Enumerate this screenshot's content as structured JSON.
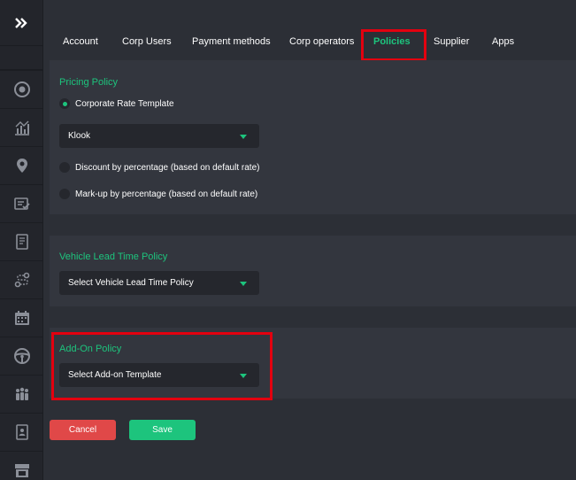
{
  "sidebar": {
    "icons": [
      "expand-icon",
      "plus-circle-icon",
      "analytics-icon",
      "location-pin-icon",
      "checklist-icon",
      "document-icon",
      "route-icon",
      "calendar-icon",
      "steering-wheel-icon",
      "users-group-icon",
      "id-card-icon",
      "storefront-icon"
    ]
  },
  "tabs": [
    {
      "label": "Account"
    },
    {
      "label": "Corp Users"
    },
    {
      "label": "Payment methods"
    },
    {
      "label": "Corp operators"
    },
    {
      "label": "Policies"
    },
    {
      "label": "Supplier"
    },
    {
      "label": "Apps"
    }
  ],
  "active_tab": "Policies",
  "pricing_policy": {
    "title": "Pricing Policy",
    "options": [
      {
        "label": "Corporate Rate Template",
        "selected": true
      },
      {
        "label": "Discount by percentage (based on default rate)",
        "selected": false
      },
      {
        "label": "Mark-up by percentage (based on default rate)",
        "selected": false
      }
    ],
    "template_value": "Klook"
  },
  "vehicle_lead_time_policy": {
    "title": "Vehicle Lead Time Policy",
    "placeholder": "Select Vehicle Lead Time Policy"
  },
  "addon_policy": {
    "title": "Add-On Policy",
    "placeholder": "Select Add-on Template"
  },
  "buttons": {
    "cancel": "Cancel",
    "save": "Save"
  },
  "colors": {
    "accent": "#1dc47d",
    "danger": "#e04848",
    "highlight": "#e3000f",
    "background": "#2c2f36",
    "panel": "#33363e"
  }
}
